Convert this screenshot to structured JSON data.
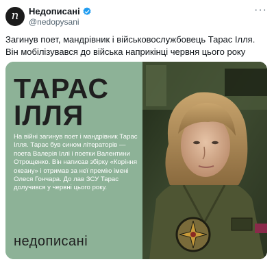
{
  "tweet": {
    "avatar_letter": "n",
    "display_name": "Недописані",
    "handle": "@nedopysani",
    "text": "Загинув поет, мандрівник і військовослужбовець Тарас Ілля. Він мобілізувався до війська наприкінці червня цього року"
  },
  "media": {
    "title_line1": "ТАРАС",
    "title_line2": "ІЛЛЯ",
    "bio": "На війні загинув поет і мандрівник Тарас Ілля. Тарас був сином літераторів — поета Валерія Іллі і поетки Валентини Отрощенко. Він написав збірку «Коріння океану» і отримав за неї премію імені Олеся Гончара. До лав ЗСУ Тарас долучився у червні цього року.",
    "logo": "недописані",
    "panel_color": "#8db297"
  },
  "icons": {
    "more": "more-options-icon",
    "verified": "verified-badge-icon"
  }
}
